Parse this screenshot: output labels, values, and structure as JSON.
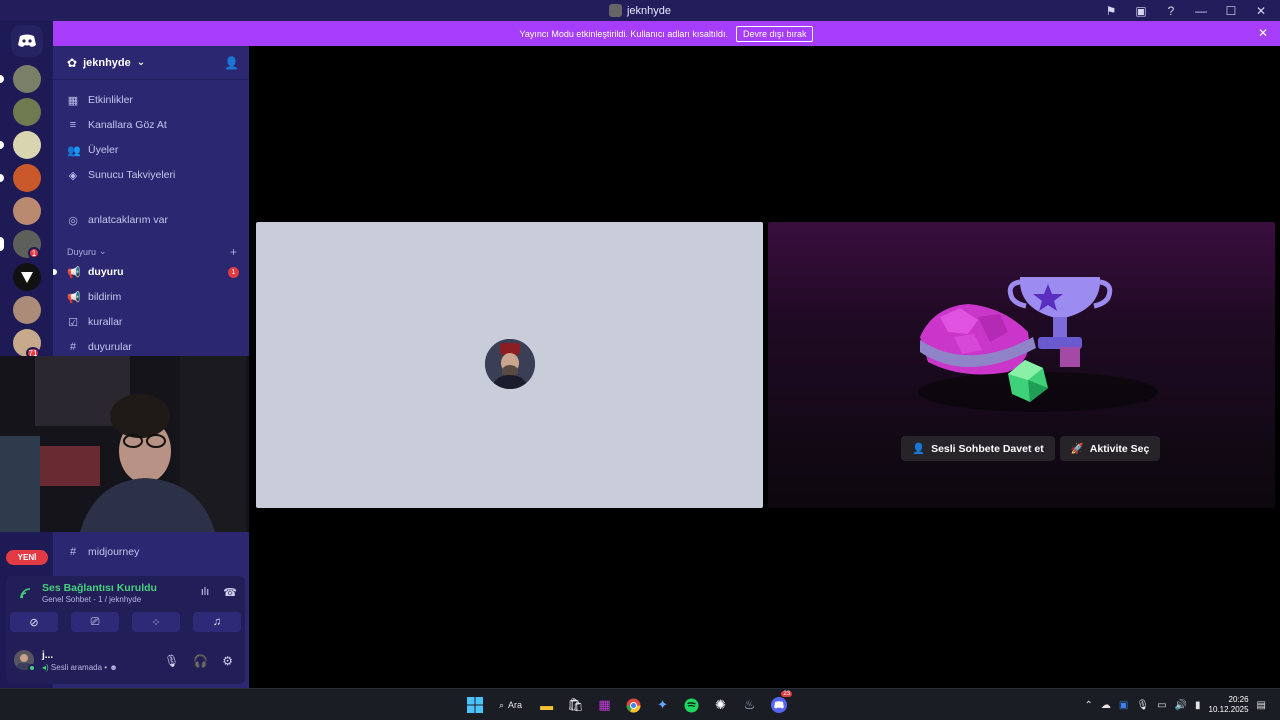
{
  "window": {
    "title": "jeknhyde",
    "controls": [
      "flag-icon",
      "inbox-icon",
      "help-icon",
      "minimize-icon",
      "maximize-icon",
      "close-icon"
    ]
  },
  "banner": {
    "text": "Yayıncı Modu etkinleştirildi. Kullanıcı adları kısaltıldı.",
    "button": "Devre dışı bırak",
    "color": "#a63dfb"
  },
  "guilds": {
    "badges": [
      "1",
      "71"
    ]
  },
  "server": {
    "name": "jeknhyde",
    "chevron": "⌄",
    "menu": [
      {
        "icon": "▦",
        "label": "Etkinlikler"
      },
      {
        "icon": "≡",
        "label": "Kanallara Göz At"
      },
      {
        "icon": "👥",
        "label": "Üyeler"
      },
      {
        "icon": "◈",
        "label": "Sunucu Takviyeleri"
      }
    ],
    "stage": {
      "icon": "◎",
      "label": "anlatcaklarım var"
    },
    "category": {
      "label": "Duyuru",
      "chevron": "⌄",
      "plus": "+"
    },
    "channels": [
      {
        "icon": "📢",
        "label": "duyuru",
        "badge": "1"
      },
      {
        "icon": "📢",
        "label": "bildirim"
      },
      {
        "icon": "☑",
        "label": "kurallar"
      },
      {
        "icon": "#",
        "label": "duyurular"
      }
    ],
    "lower_channel": {
      "icon": "#",
      "label": "midjourney"
    },
    "new_badge": "YENİ"
  },
  "voice": {
    "status": "Ses Bağlantısı Kuruldu",
    "channel": "Genel Sohbet - 1 / jeknhyde",
    "status_color": "#44d27b"
  },
  "user": {
    "name": "j...",
    "status": "Sesli aramada •"
  },
  "activity": {
    "invite_button": "Sesli Sohbete Davet et",
    "activity_button": "Aktivite Seç"
  },
  "taskbar": {
    "search": "Ara",
    "discord_badge": "23",
    "time": "20:26",
    "date": "10.12.2025"
  }
}
